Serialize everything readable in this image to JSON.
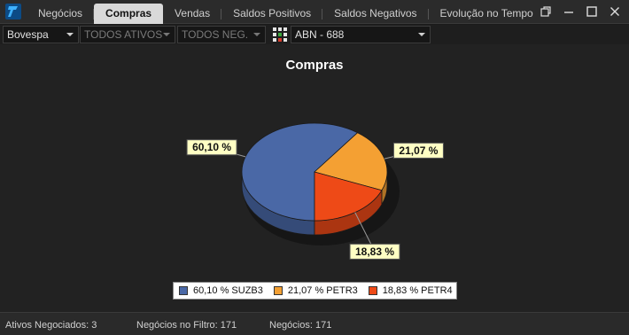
{
  "tabs": [
    {
      "label": "Negócios",
      "active": false
    },
    {
      "label": "Compras",
      "active": true
    },
    {
      "label": "Vendas",
      "active": false
    },
    {
      "label": "Saldos Positivos",
      "active": false
    },
    {
      "label": "Saldos Negativos",
      "active": false
    },
    {
      "label": "Evolução no Tempo",
      "active": false
    }
  ],
  "filters": {
    "exchange": "Bovespa",
    "assets": "TODOS ATIVOS",
    "trades": "TODOS NEG.",
    "broker": "ABN - 688"
  },
  "chart": {
    "title": "Compras"
  },
  "chart_data": {
    "type": "pie",
    "title": "Compras",
    "slices": [
      {
        "label": "60,10 %",
        "name": "SUZB3",
        "value": 60.1,
        "color": "#4a68a6"
      },
      {
        "label": "21,07 %",
        "name": "PETR3",
        "value": 21.07,
        "color": "#f4a033"
      },
      {
        "label": "18,83 %",
        "name": "PETR4",
        "value": 18.83,
        "color": "#ee4a17"
      }
    ],
    "legend": [
      "60,10 % SUZB3",
      "21,07 % PETR3",
      "18,83 % PETR4"
    ],
    "legend_position": "bottom"
  },
  "status": {
    "ativos": "Ativos Negociados: 3",
    "filtro": "Negócios no Filtro: 171",
    "negocios": "Negócios: 171"
  }
}
